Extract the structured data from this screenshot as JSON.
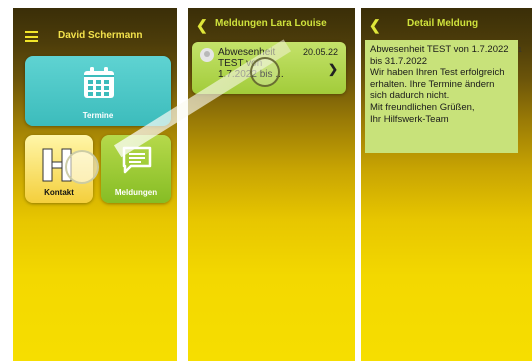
{
  "screen1": {
    "user_name": "David Schermann",
    "tiles": [
      {
        "label": "Termine",
        "icon": "calendar-icon"
      },
      {
        "label": "Kontakt",
        "icon": "hilfswerk-logo-icon"
      },
      {
        "label": "Meldungen",
        "icon": "chat-icon"
      }
    ]
  },
  "screen2": {
    "title": "Meldungen Lara Louise",
    "item": {
      "text": "Abwesenheit TEST von 1.7.2022 bis ...",
      "date": "20.05.22"
    }
  },
  "screen3": {
    "title": "Detail Meldung",
    "lines": [
      "Abwesenheit TEST von 1.7.2022 bis 31.7.2022",
      "Wir haben Ihren Test erfolgreich erhalten. Ihre Termine ändern sich dadurch nicht.",
      "Mit freundlichen Grüßen,",
      "Ihr Hilfswerk-Team"
    ],
    "overflow_marker": "1"
  },
  "colors": {
    "termine_tile": "#4cc7c6",
    "kontakt_tile": "#f6d24a",
    "meldungen_tile": "#9acb35",
    "card": "#c8e27a",
    "title_text": "#e8ea2a"
  }
}
